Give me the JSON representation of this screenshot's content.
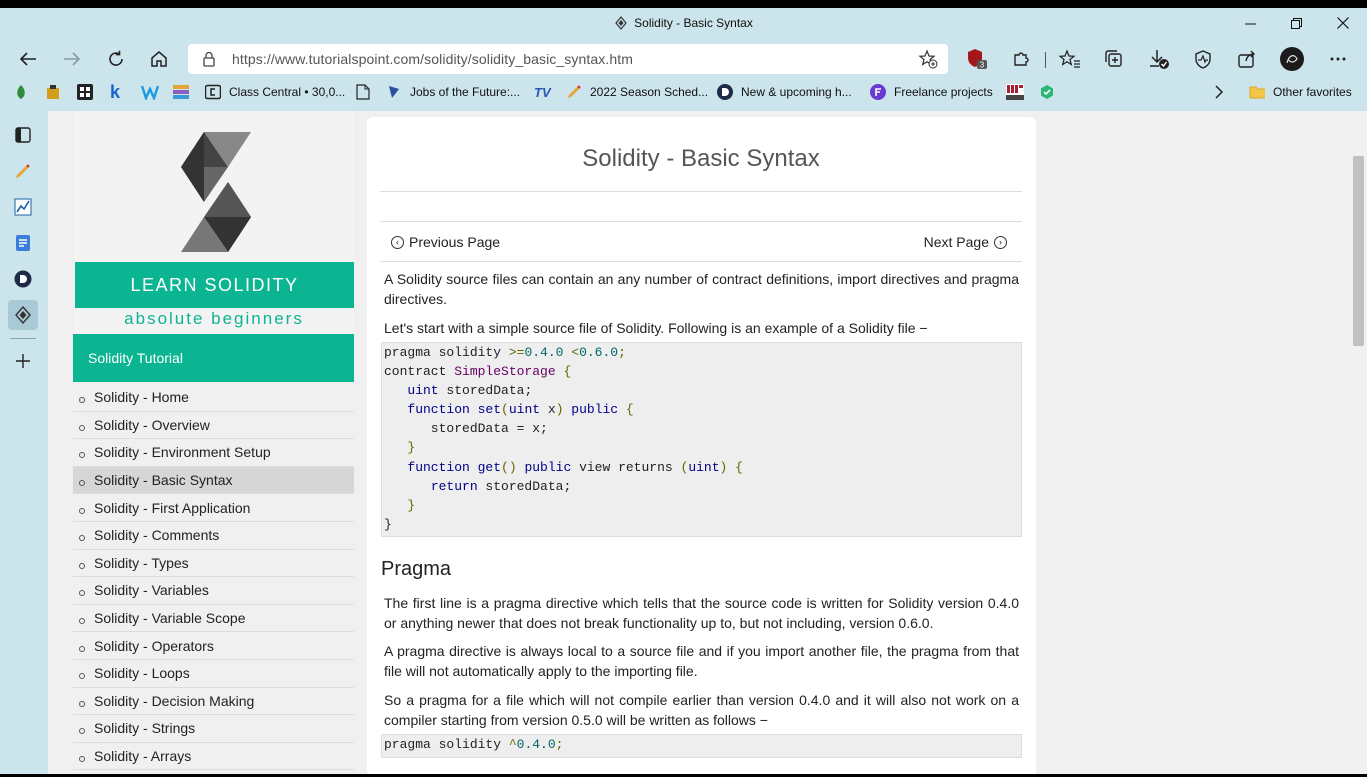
{
  "window": {
    "title": "Solidity - Basic Syntax",
    "controls": [
      "minimize",
      "restore",
      "close"
    ]
  },
  "addressbar": {
    "url": "https://www.tutorialspoint.com/solidity/solidity_basic_syntax.htm",
    "extension_badge": "3"
  },
  "favorites": {
    "items": [
      {
        "label": "Class Central • 30,0..."
      },
      {
        "label": "Jobs of the Future:..."
      },
      {
        "label": "2022 Season Sched..."
      },
      {
        "label": "New & upcoming h..."
      },
      {
        "label": "Freelance projects"
      }
    ],
    "other": "Other favorites"
  },
  "sidebar_logo": {
    "band": "LEARN SOLIDITY",
    "tagline": "absolute beginners"
  },
  "nav": {
    "heading": "Solidity Tutorial",
    "items": [
      "Solidity - Home",
      "Solidity - Overview",
      "Solidity - Environment Setup",
      "Solidity - Basic Syntax",
      "Solidity - First Application",
      "Solidity - Comments",
      "Solidity - Types",
      "Solidity - Variables",
      "Solidity - Variable Scope",
      "Solidity - Operators",
      "Solidity - Loops",
      "Solidity - Decision Making",
      "Solidity - Strings",
      "Solidity - Arrays"
    ],
    "active_index": 3
  },
  "article": {
    "title": "Solidity - Basic Syntax",
    "prev": "Previous Page",
    "next": "Next Page",
    "p1": "A Solidity source files can contain an any number of contract definitions, import directives and pragma directives.",
    "p2": "Let's start with a simple source file of Solidity. Following is an example of a Solidity file −",
    "h_pragma": "Pragma",
    "p3": "The first line is a pragma directive which tells that the source code is written for Solidity version 0.4.0 or anything newer that does not break functionality up to, but not including, version 0.6.0.",
    "p4": "A pragma directive is always local to a source file and if you import another file, the pragma from that file will not automatically apply to the importing file.",
    "p5": "So a pragma for a file which will not compile earlier than version 0.4.0 and it will also not work on a compiler starting from version 0.5.0 will be written as follows −",
    "code2": "pragma solidity ^0.4.0;"
  },
  "code1": {
    "l1_a": "pragma solidity ",
    "l1_b": ">=",
    "l1_c": "0.4.0",
    "l1_d": " <",
    "l1_e": "0.6.0",
    "l1_f": ";",
    "l2_a": "contract ",
    "l2_b": "SimpleStorage",
    "l2_c": " {",
    "l3_a": "   ",
    "l3_b": "uint",
    "l3_c": " storedData;",
    "l4_a": "   ",
    "l4_b": "function",
    "l4_c": " set",
    "l4_d": "(",
    "l4_e": "uint",
    "l4_f": " x",
    "l4_g": ")",
    "l4_h": " public ",
    "l4_i": "{",
    "l5": "      storedData = x;",
    "l6_a": "   ",
    "l6_b": "}",
    "l7_a": "   ",
    "l7_b": "function",
    "l7_c": " get",
    "l7_d": "()",
    "l7_e": " public ",
    "l7_f": "view returns ",
    "l7_g": "(",
    "l7_h": "uint",
    "l7_i": ")",
    "l7_j": " {",
    "l8_a": "      ",
    "l8_b": "return",
    "l8_c": " storedData;",
    "l9_a": "   ",
    "l9_b": "}",
    "l10": "}"
  },
  "code2_parts": {
    "a": "pragma solidity ",
    "b": "^",
    "c": "0.4.0",
    "d": ";"
  }
}
